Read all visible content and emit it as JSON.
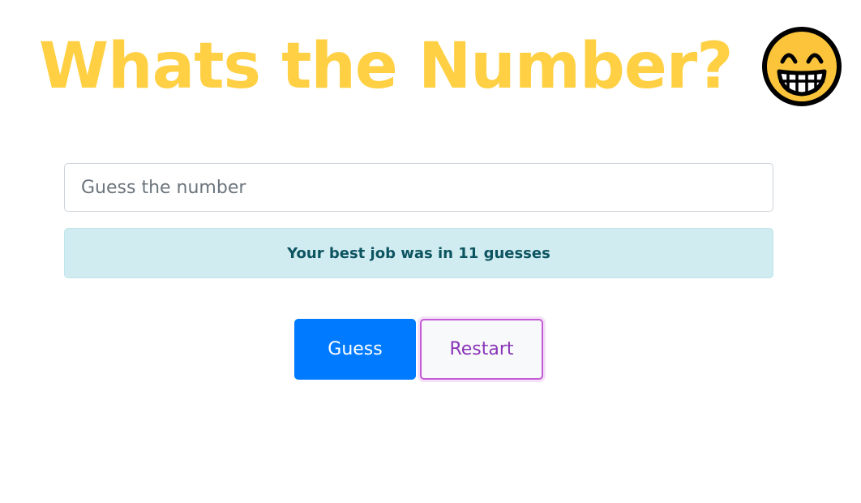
{
  "header": {
    "title": "Whats the Number?",
    "emoji_icon": "grinning-face-icon"
  },
  "guess_input": {
    "value": "",
    "placeholder": "Guess the number"
  },
  "status": {
    "message": "Your best job was in 11 guesses"
  },
  "buttons": {
    "guess_label": "Guess",
    "restart_label": "Restart"
  },
  "colors": {
    "title": "#ffd043",
    "emoji_face": "#fcc43b",
    "alert_bg": "#d1ecf1",
    "alert_text": "#0c5460",
    "guess_bg": "#007bff",
    "restart_text": "#8a35b8",
    "restart_border": "#c45ad6"
  }
}
